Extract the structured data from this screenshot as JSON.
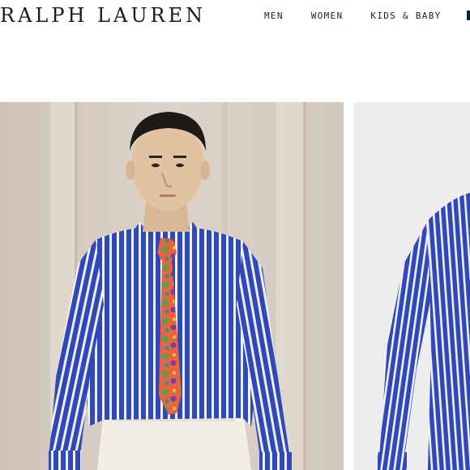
{
  "brand": {
    "logo_text": "RALPH LAUREN"
  },
  "nav": {
    "items": [
      "MEN",
      "WOMEN",
      "KIDS & BABY"
    ]
  },
  "products": [
    {
      "image": "model wearing blue striped dress shirt with paisley tie"
    },
    {
      "image": "blue striped dress shirt product shot"
    }
  ],
  "colors": {
    "shirt_blue": "#3048b8",
    "stripe_white": "#ffffff",
    "tie_orange": "#e8643c",
    "wall": "#d9cfc6",
    "product_bg": "#ededed",
    "nav_text": "#0e2239"
  }
}
